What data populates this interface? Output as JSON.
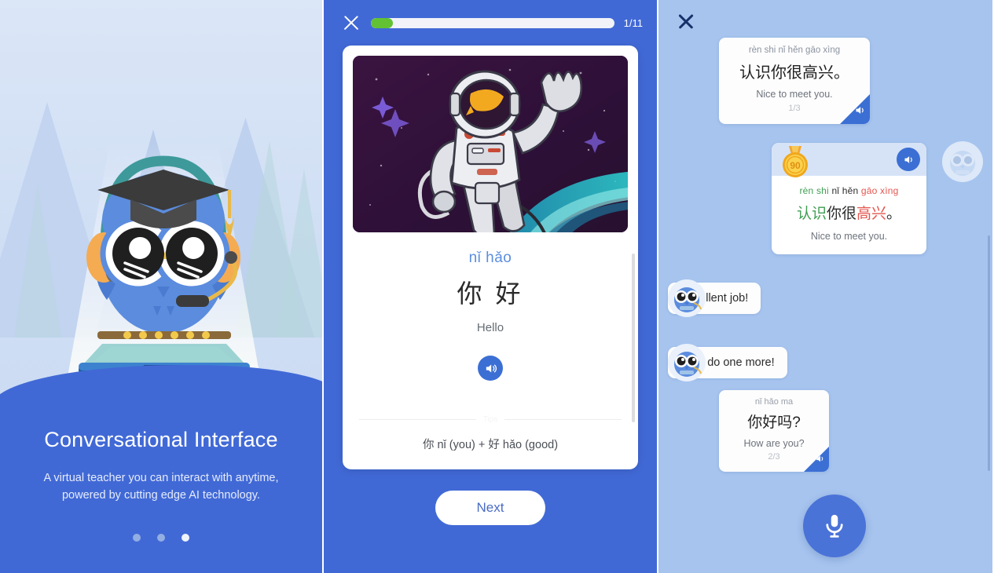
{
  "onboarding": {
    "title": "Conversational Interface",
    "subtitle_line1": "A virtual teacher you can interact with anytime,",
    "subtitle_line2": "powered by cutting edge AI technology.",
    "dots": [
      {
        "name": "page-dot-1",
        "active": false
      },
      {
        "name": "page-dot-2",
        "active": false
      },
      {
        "name": "page-dot-3",
        "active": true
      }
    ],
    "illustration": "owl-teacher-hologram",
    "accent_color": "#4169d6",
    "background_color": "#cfdef4"
  },
  "lesson": {
    "close_icon": "close-icon",
    "progress_label": "1/11",
    "progress_percent": 9,
    "progress_fill_color": "#62c233",
    "image_alt": "astronaut-waving-in-space",
    "pinyin": "nǐ hǎo",
    "hanzi": "你 好",
    "english": "Hello",
    "speaker_icon": "speaker-icon",
    "tips_divider_label": "Tips",
    "tips_text": "你 nǐ (you) + 好 hǎo (good)",
    "next_label": "Next",
    "panel_color": "#4169d6"
  },
  "chat": {
    "close_icon": "close-icon",
    "panel_color": "#a6c4ee",
    "prompt_bubble": {
      "pinyin": "rèn shi nǐ hěn gāo xìng",
      "hanzi": "认识你很高兴。",
      "english": "Nice to meet you.",
      "counter": "1/3",
      "speaker_icon": "speaker-icon"
    },
    "score_bubble": {
      "score": "90",
      "medal_icon": "medal-icon",
      "speaker_icon": "speaker-icon",
      "pinyin_tokens": [
        {
          "text": "rèn shi ",
          "color": "green"
        },
        {
          "text": "nǐ hěn ",
          "color": "dark"
        },
        {
          "text": "gāo xìng",
          "color": "red"
        }
      ],
      "hanzi_tokens": [
        {
          "text": "认识",
          "color": "green"
        },
        {
          "text": "你很",
          "color": "dark"
        },
        {
          "text": "高兴",
          "color": "red"
        },
        {
          "text": "。",
          "color": "dark"
        }
      ],
      "english": "Nice to meet you.",
      "color_green": "#3f9e52",
      "color_red": "#e4564f",
      "color_dark": "#2c2c2c"
    },
    "avatar_icon": "owl-avatar",
    "messages": [
      {
        "avatar": "owl-avatar",
        "text": "Excellent job!"
      },
      {
        "avatar": "owl-avatar",
        "text": "Let's do one more!"
      }
    ],
    "next_prompt_bubble": {
      "pinyin": "nǐ hǎo ma",
      "hanzi": "你好吗?",
      "english": "How are you?",
      "counter": "2/3",
      "speaker_icon": "speaker-icon"
    },
    "mic_icon": "microphone-icon",
    "mic_color": "#4a73d8"
  }
}
